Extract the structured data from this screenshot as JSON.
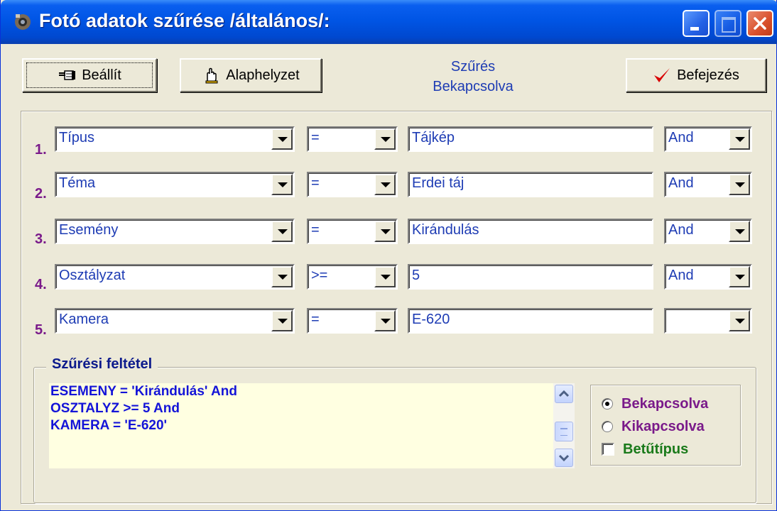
{
  "window": {
    "title": "Fotó adatok szűrése /általános/:",
    "controls": [
      "minimize",
      "maximize",
      "close"
    ]
  },
  "toolbar": {
    "set_label": "Beállít",
    "reset_label": "Alaphelyzet",
    "finish_label": "Befejezés",
    "set_icon": "pointing-hand-icon",
    "reset_icon": "raised-hand-icon",
    "finish_icon": "red-checkmark-icon"
  },
  "status": {
    "line1": "Szűrés",
    "line2": "Bekapcsolva"
  },
  "rows": [
    {
      "num": "1.",
      "field": "Típus",
      "operator": "=",
      "value": "Tájkép",
      "logic": "And"
    },
    {
      "num": "2.",
      "field": "Téma",
      "operator": "=",
      "value": "Erdei táj",
      "logic": "And"
    },
    {
      "num": "3.",
      "field": "Esemény",
      "operator": "=",
      "value": "Kirándulás",
      "logic": "And"
    },
    {
      "num": "4.",
      "field": "Osztályzat",
      "operator": ">=",
      "value": "5",
      "logic": "And"
    },
    {
      "num": "5.",
      "field": "Kamera",
      "operator": "=",
      "value": "E-620",
      "logic": ""
    }
  ],
  "filter": {
    "legend": "Szűrési feltétel",
    "lines": [
      "ESEMENY = 'Kirándulás' And",
      "OSZTALYZ >= 5 And",
      "KAMERA = 'E-620'"
    ]
  },
  "options": {
    "on_label": "Bekapcsolva",
    "off_label": "Kikapcsolva",
    "font_label": "Betűtípus",
    "selected": "on",
    "font_checked": false
  },
  "colors": {
    "row_number": "#7a1a8a",
    "field_text": "#1e3cb4",
    "memo_text": "#1414d8",
    "memo_background": "#ffffe1",
    "option_purple": "#7a1a8a",
    "option_green": "#1a7a1a"
  }
}
